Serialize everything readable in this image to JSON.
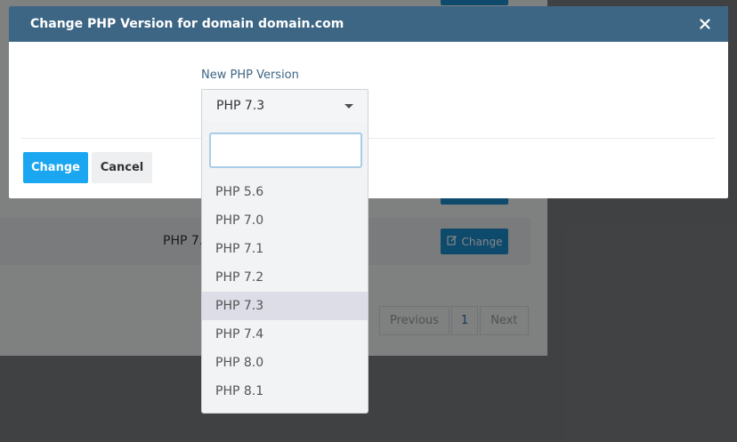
{
  "background": {
    "row_version": "PHP 7.4",
    "row_button_label": "Change",
    "pagination": {
      "previous": "Previous",
      "current_page": "1",
      "next": "Next"
    }
  },
  "modal": {
    "title": "Change PHP Version for domain domain.com",
    "field_label": "New PHP Version",
    "selected_value": "PHP 7.3",
    "change_button": "Change",
    "cancel_button": "Cancel"
  },
  "dropdown": {
    "search_value": "",
    "options": [
      "PHP 5.6",
      "PHP 7.0",
      "PHP 7.1",
      "PHP 7.2",
      "PHP 7.3",
      "PHP 7.4",
      "PHP 8.0",
      "PHP 8.1"
    ],
    "highlighted": "PHP 7.3"
  },
  "colors": {
    "header": "#3d6685",
    "primary_button": "#1aa6f0",
    "background_button": "#1b8fd0",
    "highlight": "#dcdde6"
  }
}
